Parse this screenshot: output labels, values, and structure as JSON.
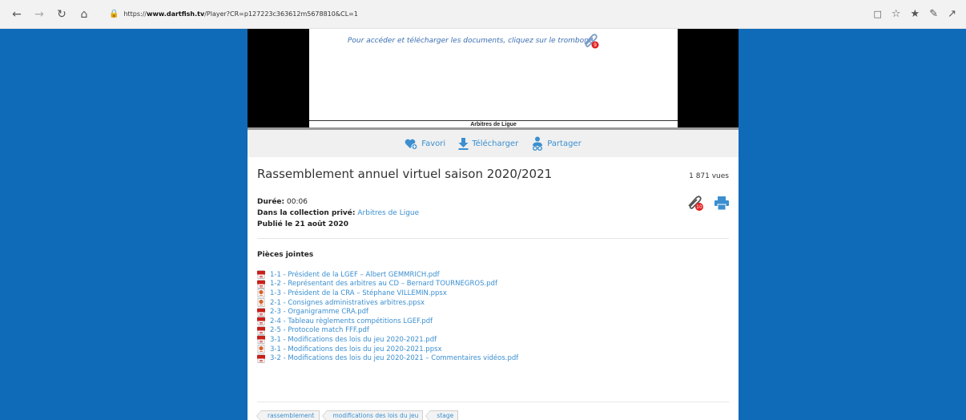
{
  "browser": {
    "url_prefix": "https://",
    "url_domain": "www.dartfish.tv",
    "url_path": "/Player?CR=p127223c363612m5678810&CL=1"
  },
  "slide": {
    "instruction": "Pour accéder et télécharger les documents, cliquez sur le trombone",
    "clip_badge": "9",
    "footer": "Arbitres de Ligue"
  },
  "actions": {
    "favori": "Favori",
    "telecharger": "Télécharger",
    "partager": "Partager"
  },
  "video": {
    "title": "Rassemblement annuel virtuel saison 2020/2021",
    "views": "1 871 vues",
    "duration_label": "Durée:",
    "duration": "00:06",
    "collection_label": "Dans la collection privé:",
    "collection": "Arbitres de Ligue",
    "published": "Publié le 21 août 2020",
    "attachment_count": "10"
  },
  "attachments": {
    "heading": "Pièces jointes",
    "items": [
      {
        "label": "1-1 - Président de la LGEF – Albert GEMMRICH.pdf",
        "type": "pdf"
      },
      {
        "label": "1-2 - Représentant des arbitres au CD – Bernard TOURNEGROS.pdf",
        "type": "pdf"
      },
      {
        "label": "1-3 - Président de la CRA – Stéphane VILLEMIN.ppsx",
        "type": "ppsx"
      },
      {
        "label": "2-1 - Consignes administratives arbitres.ppsx",
        "type": "ppsx"
      },
      {
        "label": "2-3 - Organigramme CRA.pdf",
        "type": "pdf"
      },
      {
        "label": "2-4 - Tableau règlements compétitions LGEF.pdf",
        "type": "pdf"
      },
      {
        "label": "2-5 - Protocole match FFF.pdf",
        "type": "pdf"
      },
      {
        "label": "3-1 - Modifications des lois du jeu 2020-2021.pdf",
        "type": "pdf"
      },
      {
        "label": "3-1 - Modifications des lois du jeu 2020-2021.ppsx",
        "type": "ppsx"
      },
      {
        "label": "3-2 - Modifications des lois du jeu 2020-2021 – Commentaires vidéos.pdf",
        "type": "pdf"
      }
    ]
  },
  "tags": [
    "rassemblement",
    "modifications des lois du jeu",
    "stage"
  ],
  "colors": {
    "page_bg": "#0f6bb8",
    "link": "#3b8fd0",
    "badge": "#e02020"
  }
}
